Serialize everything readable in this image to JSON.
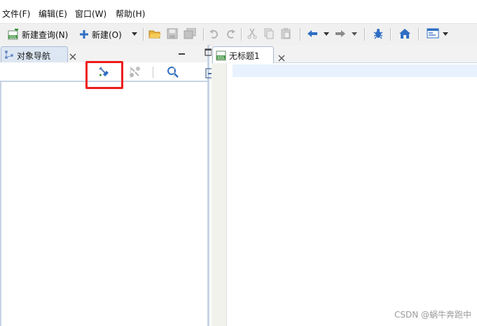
{
  "menu": {
    "file": "文件(F)",
    "edit": "编辑(E)",
    "window": "窗口(W)",
    "help": "帮助(H)"
  },
  "toolbar": {
    "new_query": "新建查询(N)",
    "new": "新建(O)"
  },
  "left_panel": {
    "tab_label": "对象导航"
  },
  "editor": {
    "tab_label": "无标题1"
  },
  "watermark": "CSDN @蜗牛奔跑中",
  "colors": {
    "highlight": "#ee1c1c",
    "accent_blue": "#2f6fc4",
    "icon_green": "#4a9a4a"
  },
  "icons": [
    "sql-new-icon",
    "plus-icon",
    "dropdown-icon",
    "folder-open-icon",
    "save-icon",
    "save-all-icon",
    "undo-icon",
    "redo-icon",
    "cut-icon",
    "copy-icon",
    "paste-icon",
    "back-arrow-icon",
    "forward-arrow-icon",
    "debug-bug-icon",
    "home-icon",
    "window-icon",
    "connect-icon",
    "disconnect-icon",
    "search-icon",
    "collapse-icon",
    "expand-icon",
    "view-menu-icon",
    "close-icon",
    "minimize-icon",
    "maximize-icon"
  ]
}
